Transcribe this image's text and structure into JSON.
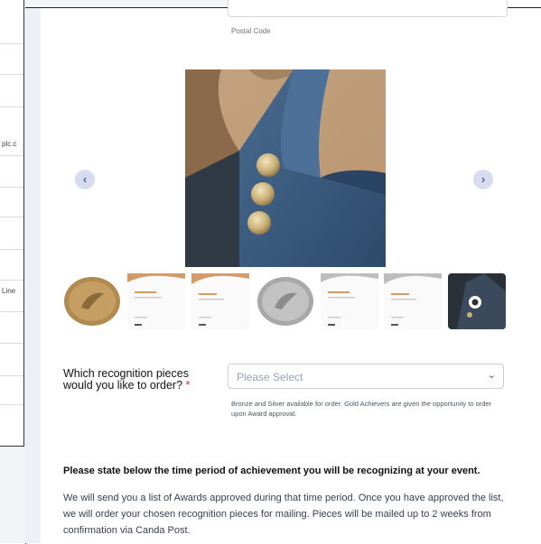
{
  "background_left_fragments": [
    "plc.c",
    "Line"
  ],
  "address": {
    "postal_code_label": "Postal Code"
  },
  "gallery": {
    "main_image_icon": "jacket-pins-photo",
    "prev_icon": "chevron-left-icon",
    "next_icon": "chevron-right-icon",
    "prev_glyph": "‹",
    "next_glyph": "›",
    "thumbnails": [
      {
        "name": "bronze-pin",
        "caption": ""
      },
      {
        "name": "certificate-bronze",
        "caption": "BRONZE STANDARD"
      },
      {
        "name": "certificate-bronze-2",
        "caption": "BRONZE AWARD"
      },
      {
        "name": "silver-pin",
        "caption": ""
      },
      {
        "name": "certificate-silver",
        "caption": "SILVER STANDARD"
      },
      {
        "name": "certificate-silver-2",
        "caption": "SPECIAL AWARD"
      },
      {
        "name": "jacket-photo",
        "caption": ""
      }
    ]
  },
  "order": {
    "question": "Which recognition pieces would you like to order?",
    "required_mark": "*",
    "select_placeholder": "Please Select",
    "chevron_glyph": "⌄",
    "helper_text": "Bronze and Silver available for order. Gold Achievers are given the opportunity to order upon Award approval."
  },
  "period": {
    "heading": "Please state below the time period of achievement you will be recognizing at your event.",
    "description": "We will send you a list of Awards approved during that time period. Once you have approved the list, we will order your chosen recognition pieces for mailing. Pieces will be mailed up to 2 weeks from confirmation via Canda Post."
  },
  "colors": {
    "accent": "#d7dcef",
    "required": "#dc2626",
    "bronze": "#b08a4e",
    "silver": "#a8a8a8",
    "denim": "#3a5a7e"
  }
}
